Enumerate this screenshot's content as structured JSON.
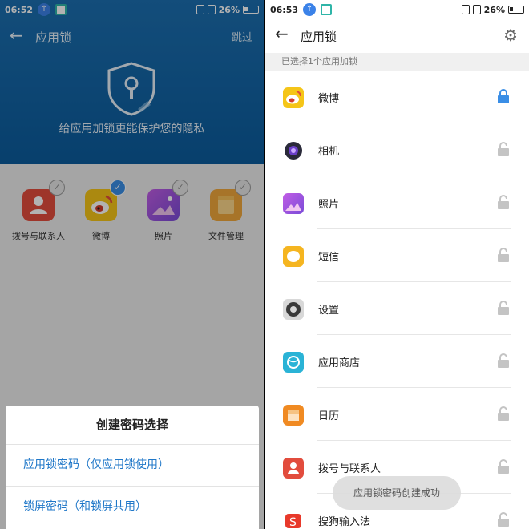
{
  "left": {
    "status": {
      "time": "06:52",
      "battery": "26%"
    },
    "header": {
      "title": "应用锁",
      "skip": "跳过",
      "caption": "给应用加锁更能保护您的隐私"
    },
    "apps": [
      {
        "label": "拨号与联系人",
        "icon": "contacts-icon",
        "color": "#e24c3d",
        "checked": false
      },
      {
        "label": "微博",
        "icon": "weibo-icon",
        "color": "#f5c518",
        "checked": true
      },
      {
        "label": "照片",
        "icon": "photos-icon",
        "color": "#9b5de5",
        "checked": false
      },
      {
        "label": "文件管理",
        "icon": "file-manager-icon",
        "color": "#f0a63b",
        "checked": false
      }
    ],
    "dialog": {
      "title": "创建密码选择",
      "options": [
        "应用锁密码（仅应用锁使用）",
        "锁屏密码（和锁屏共用）"
      ]
    }
  },
  "right": {
    "status": {
      "time": "06:53",
      "battery": "26%"
    },
    "header": {
      "title": "应用锁"
    },
    "subtitle": "已选择1个应用加锁",
    "items": [
      {
        "label": "微博",
        "icon": "weibo-icon",
        "locked": true
      },
      {
        "label": "相机",
        "icon": "camera-icon",
        "locked": false
      },
      {
        "label": "照片",
        "icon": "photos-icon",
        "locked": false
      },
      {
        "label": "短信",
        "icon": "messages-icon",
        "locked": false
      },
      {
        "label": "设置",
        "icon": "settings-icon",
        "locked": false
      },
      {
        "label": "应用商店",
        "icon": "app-store-icon",
        "locked": false
      },
      {
        "label": "日历",
        "icon": "calendar-icon",
        "locked": false
      },
      {
        "label": "拨号与联系人",
        "icon": "contacts-icon",
        "locked": false
      },
      {
        "label": "搜狗输入法",
        "icon": "sogou-input-icon",
        "locked": false
      }
    ],
    "toast": "应用锁密码创建成功"
  },
  "colors": {
    "accent": "#1f77c8",
    "lock_on": "#3a8ee6",
    "lock_off": "#c4c4c4"
  }
}
